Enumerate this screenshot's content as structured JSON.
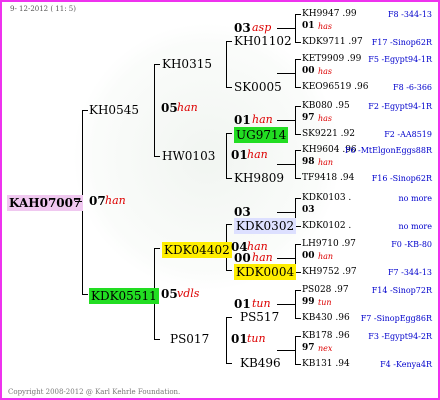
{
  "header": {
    "date": "9- 12-2012 ( 11: 5)"
  },
  "footer": {
    "copyright": "Copyright 2008-2012 @ Karl Kehrle Foundation."
  },
  "root": {
    "name": "KAH07007",
    "bg": "#f0c8f0"
  },
  "gen1": [
    {
      "name": "KH0545",
      "gen": "07",
      "code": "han"
    },
    {
      "name": "KDK05511",
      "gen": "05",
      "code": "vdls",
      "bg": "#22dd22"
    }
  ],
  "gen2": [
    {
      "name": "KH0315",
      "gen": "05",
      "code": "han"
    },
    {
      "name": "HW0103",
      "gen": "01",
      "code": "han"
    },
    {
      "name": "KDK04402",
      "gen": "04",
      "code": "han",
      "bg": "#ffee00"
    },
    {
      "name": "PS017",
      "gen": "01",
      "code": "tun"
    }
  ],
  "gen3": [
    {
      "name": "KH01102",
      "gen": "03",
      "code": "asp"
    },
    {
      "name": "SK0005",
      "gen": "",
      "code": ""
    },
    {
      "name": "UG9714",
      "gen": "01",
      "code": "han",
      "bg": "#22dd22"
    },
    {
      "name": "KH9809",
      "gen": "",
      "code": ""
    },
    {
      "name": "KDK0302",
      "gen": "03",
      "code": "",
      "bg": "#dde0ff"
    },
    {
      "name": "KDK0004",
      "gen": "00",
      "code": "han",
      "bg": "#ffee00"
    },
    {
      "name": "PS517",
      "gen": "01",
      "code": "tun"
    },
    {
      "name": "KB496",
      "gen": "",
      "code": ""
    }
  ],
  "gen4": [
    {
      "top": "KH9947 .99",
      "topInfo": "F8 -344-13",
      "gen": "01",
      "code": "has",
      "bot": "KDK9711 .97",
      "botInfo": "F17 -Sinop62R"
    },
    {
      "top": "KET9909 .99",
      "topInfo": "F5 -Egypt94-1R",
      "gen": "00",
      "code": "has",
      "bot": "KEO96519 .96",
      "botInfo": "F8 -6-366"
    },
    {
      "top": "KB080 .95",
      "topInfo": "F2 -Egypt94-1R",
      "gen": "97",
      "code": "has",
      "bot": "SK9221 .92",
      "botInfo": "F2 -AA8519"
    },
    {
      "top": "KH9604 .96",
      "topInfo": "F6 -MtElgonEggs88R",
      "gen": "98",
      "code": "han",
      "bot": "TF9418 .94",
      "botInfo": "F16 -Sinop62R"
    },
    {
      "top": "KDK0103 .",
      "topInfo": "no more",
      "gen": "03",
      "code": "",
      "bot": "KDK0102 .",
      "botInfo": "no more"
    },
    {
      "top": "LH9710 .97",
      "topInfo": "F0 -KB-80",
      "gen": "00",
      "code": "han",
      "bot": "KH9752 .97",
      "botInfo": "F7 -344-13"
    },
    {
      "top": "PS028 .97",
      "topInfo": "F14 -Sinop72R",
      "gen": "99",
      "code": "tun",
      "bot": "KB430 .96",
      "botInfo": "F7 -SinopEgg86R"
    },
    {
      "top": "KB178 .96",
      "topInfo": "F3 -Egypt94-2R",
      "gen": "97",
      "code": "nex",
      "bot": "KB131 .94",
      "botInfo": "F4 -Kenya4R"
    }
  ]
}
